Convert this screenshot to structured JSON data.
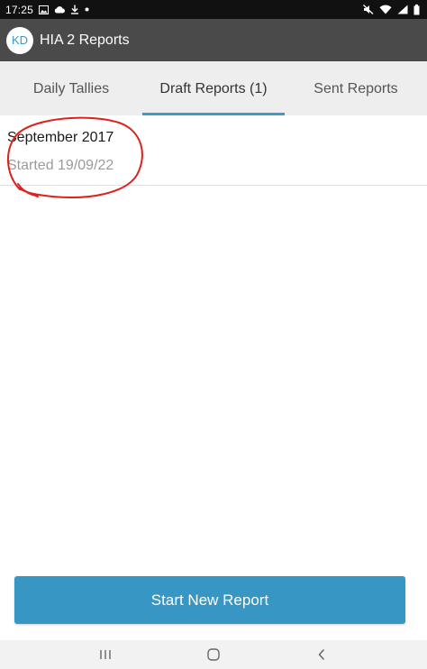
{
  "status_bar": {
    "time": "17:25",
    "left_icons": [
      "image-icon",
      "cloud-icon",
      "download-icon",
      "dot-icon"
    ],
    "right_icons": [
      "mute-icon",
      "wifi-icon",
      "signal-icon",
      "battery-icon"
    ]
  },
  "app_bar": {
    "avatar_initials": "KD",
    "title": "HIA 2 Reports"
  },
  "tabs": [
    {
      "label": "Daily Tallies",
      "active": false
    },
    {
      "label": "Draft Reports (1)",
      "active": true
    },
    {
      "label": "Sent Reports",
      "active": false
    }
  ],
  "drafts": [
    {
      "title": "September 2017",
      "subtitle": "Started 19/09/22"
    }
  ],
  "annotation": {
    "shape": "hand-drawn circle",
    "color": "#e0201c"
  },
  "actions": {
    "start_new_report_label": "Start New Report"
  },
  "nav_bar": {
    "icons": [
      "recent-apps-icon",
      "home-icon",
      "back-icon"
    ]
  },
  "colors": {
    "accent": "#3a9cc8",
    "button": "#3796c4",
    "app_bar": "#4a4a4a",
    "tabs_bg": "#eeeeee"
  }
}
